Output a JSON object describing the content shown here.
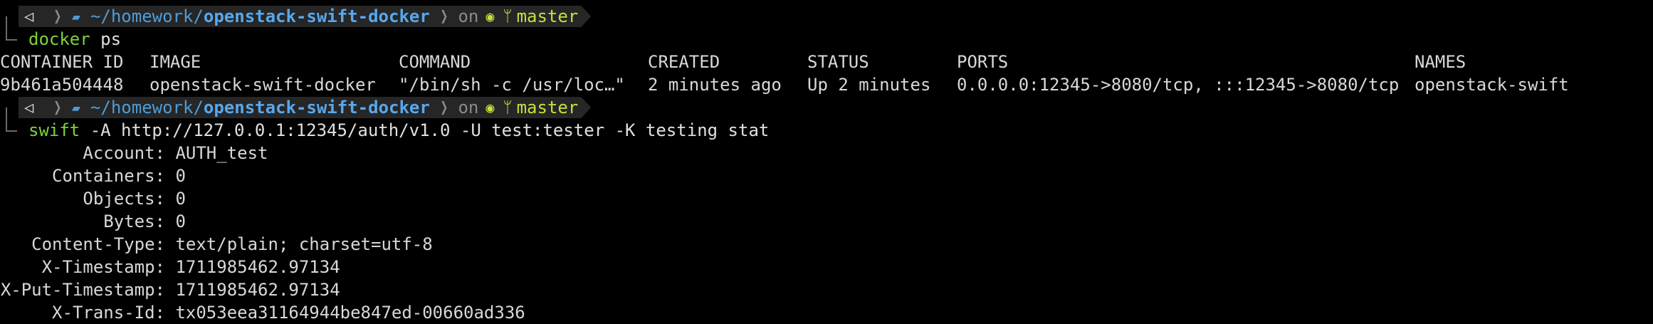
{
  "prompt": {
    "os_icon": "apple-logo-icon",
    "path_prefix": "~/homework/",
    "path_repo": "openstack-swift-docker",
    "on_text": "on",
    "vcs_icon": "github-octocat-icon",
    "branch_icon": "git-branch-icon",
    "branch": "master"
  },
  "cmd1": {
    "program": "docker",
    "args": " ps"
  },
  "ps_table": {
    "headers": [
      "CONTAINER ID",
      "IMAGE",
      "COMMAND",
      "CREATED",
      "STATUS",
      "PORTS",
      "NAMES"
    ],
    "row": [
      "9b461a504448",
      "openstack-swift-docker",
      "\"/bin/sh -c /usr/loc…\"",
      "2 minutes ago",
      "Up 2 minutes",
      "0.0.0.0:12345->8080/tcp, :::12345->8080/tcp",
      "openstack-swift"
    ]
  },
  "cmd2": {
    "program": "swift",
    "args": " -A http://127.0.0.1:12345/auth/v1.0 -U test:tester -K testing stat"
  },
  "stat": [
    {
      "key": "Account:",
      "value": "AUTH_test"
    },
    {
      "key": "Containers:",
      "value": "0"
    },
    {
      "key": "Objects:",
      "value": "0"
    },
    {
      "key": "Bytes:",
      "value": "0"
    },
    {
      "key": "Content-Type:",
      "value": "text/plain; charset=utf-8"
    },
    {
      "key": "X-Timestamp:",
      "value": "1711985462.97134"
    },
    {
      "key": "X-Put-Timestamp:",
      "value": "1711985462.97134"
    },
    {
      "key": "X-Trans-Id:",
      "value": "tx053eea31164944be847ed-00660ad336"
    }
  ]
}
